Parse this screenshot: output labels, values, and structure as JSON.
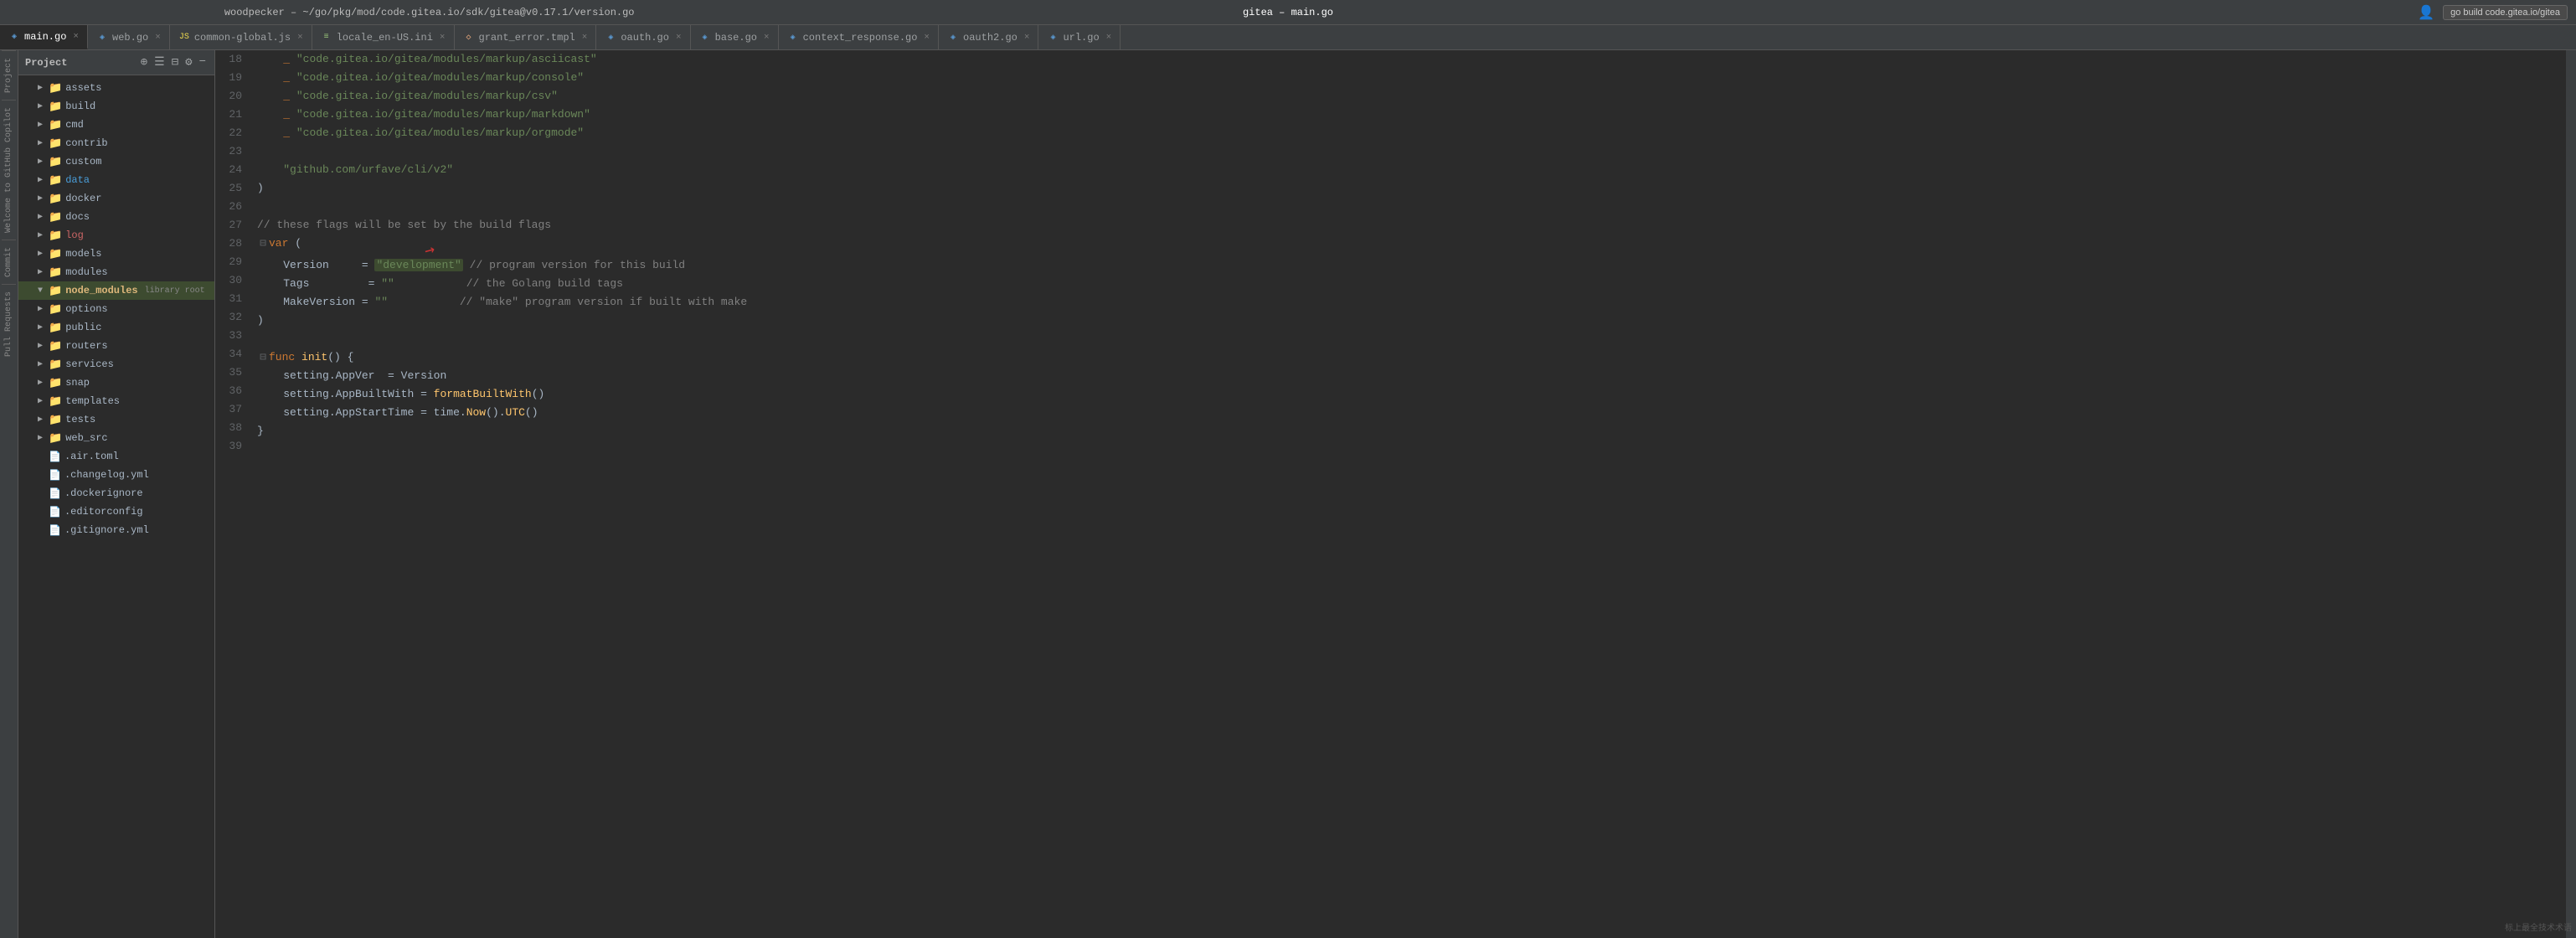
{
  "titleBar": {
    "leftTitle": "woodpecker – ~/go/pkg/mod/code.gitea.io/sdk/gitea@v0.17.1/version.go",
    "centerTitle": "gitea – main.go",
    "buildBtn": "go build code.gitea.io/gitea"
  },
  "tabs": [
    {
      "id": "main.go",
      "label": "main.go",
      "type": "go",
      "active": true
    },
    {
      "id": "web.go",
      "label": "web.go",
      "type": "go",
      "active": false
    },
    {
      "id": "common-global.js",
      "label": "common-global.js",
      "type": "js",
      "active": false
    },
    {
      "id": "locale_en-US.ini",
      "label": "locale_en-US.ini",
      "type": "txt",
      "active": false
    },
    {
      "id": "grant_error.tmpl",
      "label": "grant_error.tmpl",
      "type": "tmpl",
      "active": false
    },
    {
      "id": "oauth.go",
      "label": "oauth.go",
      "type": "go",
      "active": false
    },
    {
      "id": "base.go",
      "label": "base.go",
      "type": "go",
      "active": false
    },
    {
      "id": "context_response.go",
      "label": "context_response.go",
      "type": "go",
      "active": false
    },
    {
      "id": "oauth2.go",
      "label": "oauth2.go",
      "type": "go",
      "active": false
    },
    {
      "id": "url.go",
      "label": "url.go",
      "type": "go",
      "active": false
    }
  ],
  "fileTree": {
    "title": "Project",
    "items": [
      {
        "indent": 1,
        "type": "folder",
        "collapsed": true,
        "label": "assets",
        "color": "normal"
      },
      {
        "indent": 1,
        "type": "folder",
        "collapsed": true,
        "label": "build",
        "color": "normal"
      },
      {
        "indent": 1,
        "type": "folder",
        "collapsed": true,
        "label": "cmd",
        "color": "normal"
      },
      {
        "indent": 1,
        "type": "folder",
        "collapsed": true,
        "label": "contrib",
        "color": "normal"
      },
      {
        "indent": 1,
        "type": "folder",
        "collapsed": true,
        "label": "custom",
        "color": "normal"
      },
      {
        "indent": 1,
        "type": "folder",
        "collapsed": true,
        "label": "data",
        "color": "blue"
      },
      {
        "indent": 1,
        "type": "folder",
        "collapsed": true,
        "label": "docker",
        "color": "normal"
      },
      {
        "indent": 1,
        "type": "folder",
        "collapsed": true,
        "label": "docs",
        "color": "normal"
      },
      {
        "indent": 1,
        "type": "folder",
        "collapsed": true,
        "label": "log",
        "color": "red"
      },
      {
        "indent": 1,
        "type": "folder",
        "collapsed": true,
        "label": "models",
        "color": "normal"
      },
      {
        "indent": 1,
        "type": "folder",
        "collapsed": true,
        "label": "modules",
        "color": "normal"
      },
      {
        "indent": 1,
        "type": "folder",
        "collapsed": false,
        "label": "node_modules",
        "color": "highlighted",
        "badge": "library root"
      },
      {
        "indent": 1,
        "type": "folder",
        "collapsed": true,
        "label": "options",
        "color": "normal"
      },
      {
        "indent": 1,
        "type": "folder",
        "collapsed": true,
        "label": "public",
        "color": "normal"
      },
      {
        "indent": 1,
        "type": "folder",
        "collapsed": true,
        "label": "routers",
        "color": "normal"
      },
      {
        "indent": 1,
        "type": "folder",
        "collapsed": true,
        "label": "services",
        "color": "normal"
      },
      {
        "indent": 1,
        "type": "folder",
        "collapsed": true,
        "label": "snap",
        "color": "normal"
      },
      {
        "indent": 1,
        "type": "folder",
        "collapsed": true,
        "label": "templates",
        "color": "normal"
      },
      {
        "indent": 1,
        "type": "folder",
        "collapsed": true,
        "label": "tests",
        "color": "normal"
      },
      {
        "indent": 1,
        "type": "folder",
        "collapsed": true,
        "label": "web_src",
        "color": "normal"
      },
      {
        "indent": 1,
        "type": "file",
        "label": ".air.toml",
        "color": "normal"
      },
      {
        "indent": 1,
        "type": "file",
        "label": ".changelog.yml",
        "color": "normal",
        "fileType": "yaml"
      },
      {
        "indent": 1,
        "type": "file",
        "label": ".dockerignore",
        "color": "normal"
      },
      {
        "indent": 1,
        "type": "file",
        "label": ".editorconfig",
        "color": "normal"
      },
      {
        "indent": 1,
        "type": "file",
        "label": ".gitignore.yml",
        "color": "normal"
      }
    ]
  },
  "verticalLabels": [
    "Project",
    "Welcome to GitHub Copilot",
    "Commit",
    "Pull Requests"
  ],
  "codeLines": [
    {
      "num": 18,
      "content": "    _ \"code.gitea.io/gitea/modules/markup/asciicast\""
    },
    {
      "num": 19,
      "content": "    _ \"code.gitea.io/gitea/modules/markup/console\""
    },
    {
      "num": 20,
      "content": "    _ \"code.gitea.io/gitea/modules/markup/csv\""
    },
    {
      "num": 21,
      "content": "    _ \"code.gitea.io/gitea/modules/markup/markdown\""
    },
    {
      "num": 22,
      "content": "    _ \"code.gitea.io/gitea/modules/markup/orgmode\""
    },
    {
      "num": 23,
      "content": ""
    },
    {
      "num": 24,
      "content": "    \"github.com/urfave/cli/v2\""
    },
    {
      "num": 25,
      "content": ")"
    },
    {
      "num": 26,
      "content": ""
    },
    {
      "num": 27,
      "content": "// these flags will be set by the build flags"
    },
    {
      "num": 28,
      "content": "var (",
      "hasFold": true
    },
    {
      "num": 29,
      "content": "    Version     = \"development\" // program version for this build",
      "hasArrow": true
    },
    {
      "num": 30,
      "content": "    Tags         = \"\"           // the Golang build tags"
    },
    {
      "num": 31,
      "content": "    MakeVersion = \"\"           // \"make\" program version if built with make"
    },
    {
      "num": 32,
      "content": ")"
    },
    {
      "num": 33,
      "content": ""
    },
    {
      "num": 34,
      "content": "func init() {",
      "hasFold": true
    },
    {
      "num": 35,
      "content": "    setting.AppVer  = Version"
    },
    {
      "num": 36,
      "content": "    setting.AppBuiltWith = formatBuiltWith()"
    },
    {
      "num": 37,
      "content": "    setting.AppStartTime = time.Now().UTC()"
    },
    {
      "num": 38,
      "content": "}"
    },
    {
      "num": 39,
      "content": ""
    }
  ],
  "sidebarIcons": [
    {
      "name": "folder-icon",
      "glyph": "📁"
    },
    {
      "name": "expand-all-icon",
      "glyph": "⊞"
    },
    {
      "name": "collapse-all-icon",
      "glyph": "⊟"
    },
    {
      "name": "settings-icon",
      "glyph": "⚙"
    },
    {
      "name": "close-panel-icon",
      "glyph": "×"
    }
  ]
}
